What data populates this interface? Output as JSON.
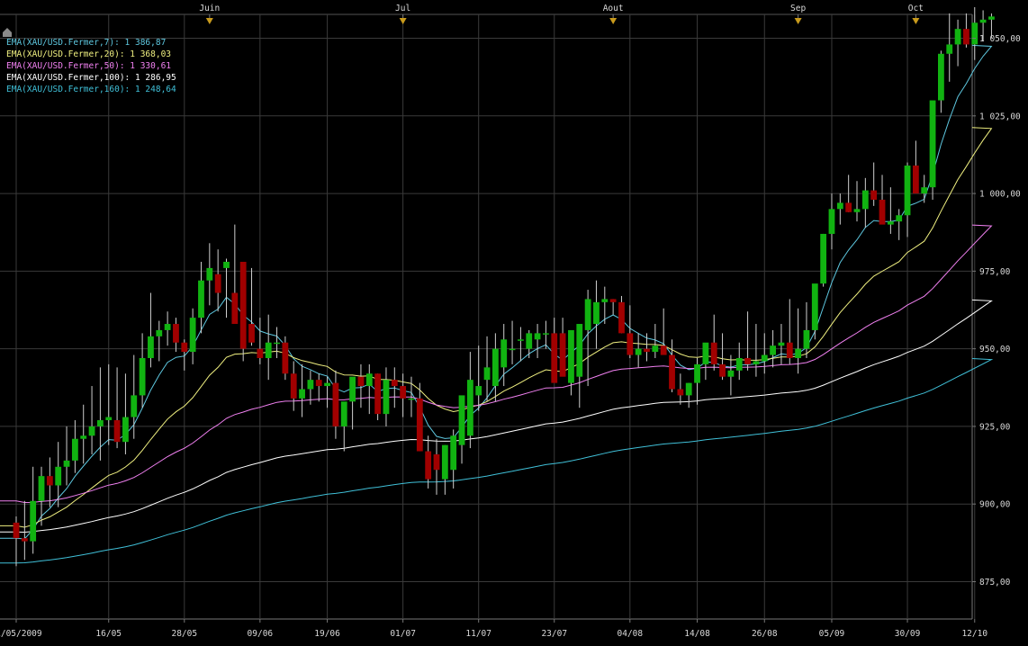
{
  "chart_data": {
    "type": "candlestick",
    "colors": {
      "up": "#11b311",
      "down": "#a10000",
      "wick": "#cfcfcf",
      "grid": "#3a3a3a",
      "axis_text": "#d9d9d9",
      "marker": "#c89a1c"
    },
    "ylim": [
      865,
      1060
    ],
    "y_ticks": [
      {
        "value": 1050,
        "label": "1 050,00"
      },
      {
        "value": 1025,
        "label": "1 025,00"
      },
      {
        "value": 1000,
        "label": "1 000,00"
      },
      {
        "value": 975,
        "label": "975,00"
      },
      {
        "value": 950,
        "label": "950,00"
      },
      {
        "value": 925,
        "label": "925,00"
      },
      {
        "value": 900,
        "label": "900,00"
      },
      {
        "value": 875,
        "label": "875,00"
      }
    ],
    "x_ticks": [
      {
        "i": 0,
        "label": "01/05/2009"
      },
      {
        "i": 11,
        "label": "16/05"
      },
      {
        "i": 20,
        "label": "28/05"
      },
      {
        "i": 29,
        "label": "09/06"
      },
      {
        "i": 37,
        "label": "19/06"
      },
      {
        "i": 46,
        "label": "01/07"
      },
      {
        "i": 55,
        "label": "11/07"
      },
      {
        "i": 64,
        "label": "23/07"
      },
      {
        "i": 73,
        "label": "04/08"
      },
      {
        "i": 81,
        "label": "14/08"
      },
      {
        "i": 89,
        "label": "26/08"
      },
      {
        "i": 97,
        "label": "05/09"
      },
      {
        "i": 106,
        "label": "30/09"
      },
      {
        "i": 114,
        "label": "12/10"
      }
    ],
    "month_markers": [
      {
        "i": 23,
        "label": "Juin"
      },
      {
        "i": 46,
        "label": "Jul"
      },
      {
        "i": 71,
        "label": "Aout"
      },
      {
        "i": 93,
        "label": "Sep"
      },
      {
        "i": 107,
        "label": "Oct"
      }
    ],
    "legend": [
      {
        "label": "EMA(XAU/USD.Fermer,7): 1 386,87",
        "color": "#5ec8e0"
      },
      {
        "label": "EMA(XAU/USD.Fermer,20): 1 368,03",
        "color": "#f0f080"
      },
      {
        "label": "EMA(XAU/USD.Fermer,50): 1 330,61",
        "color": "#f080f0"
      },
      {
        "label": "EMA(XAU/USD.Fermer,100): 1 286,95",
        "color": "#ffffff"
      },
      {
        "label": "EMA(XAU/USD.Fermer,160): 1 248,64",
        "color": "#40c0d8"
      }
    ],
    "series": {
      "open": [
        894,
        889,
        888,
        901,
        909,
        906,
        912,
        914,
        921,
        922,
        925,
        927,
        927,
        920,
        928,
        935,
        947,
        954,
        956,
        958,
        952,
        949,
        960,
        972,
        974,
        976,
        968,
        978,
        958,
        950,
        947,
        952,
        952,
        942,
        934,
        937,
        940,
        938,
        939,
        925,
        933,
        941,
        938,
        942,
        929,
        940,
        938,
        934,
        934,
        917,
        916,
        908,
        911,
        919,
        922,
        935,
        940,
        938,
        944,
        950,
        953,
        950,
        953,
        955,
        955,
        955,
        939,
        941,
        956,
        958,
        965,
        966,
        965,
        955,
        948,
        950,
        949,
        951,
        948,
        937,
        935,
        939,
        945,
        952,
        945,
        941,
        943,
        947,
        945,
        946,
        948,
        951,
        952,
        947,
        950,
        956,
        971,
        987,
        995,
        997,
        994,
        995,
        1001,
        998,
        990,
        991,
        993,
        1009,
        1000,
        1002,
        1030,
        1045,
        1048,
        1053,
        1048,
        1055,
        1056
      ],
      "high": [
        896,
        901,
        912,
        912,
        915,
        920,
        925,
        927,
        932,
        938,
        944,
        945,
        944,
        942,
        948,
        955,
        968,
        959,
        962,
        960,
        953,
        963,
        978,
        984,
        982,
        979,
        990,
        978,
        976,
        960,
        961,
        957,
        954,
        946,
        945,
        943,
        942,
        941,
        943,
        930,
        939,
        945,
        945,
        942,
        944,
        944,
        942,
        941,
        939,
        922,
        921,
        919,
        924,
        932,
        949,
        951,
        954,
        955,
        958,
        959,
        957,
        956,
        958,
        959,
        960,
        960,
        950,
        948,
        969,
        972,
        970,
        966,
        967,
        964,
        955,
        955,
        958,
        963,
        953,
        942,
        939,
        947,
        951,
        961,
        955,
        948,
        952,
        962,
        958,
        955,
        956,
        958,
        966,
        963,
        965,
        969,
        987,
        1000,
        1000,
        1006,
        1004,
        1005,
        1010,
        1006,
        1002,
        995,
        1010,
        1017,
        1006,
        1020,
        1046,
        1058,
        1056,
        1058,
        1060,
        1059,
        1058
      ],
      "low": [
        880,
        882,
        884,
        893,
        899,
        899,
        906,
        910,
        913,
        916,
        914,
        919,
        918,
        916,
        921,
        931,
        944,
        946,
        951,
        949,
        943,
        945,
        955,
        964,
        962,
        960,
        965,
        946,
        951,
        945,
        940,
        947,
        940,
        930,
        928,
        932,
        933,
        931,
        921,
        917,
        924,
        931,
        929,
        927,
        925,
        931,
        928,
        928,
        917,
        905,
        903,
        903,
        905,
        913,
        918,
        930,
        933,
        933,
        938,
        945,
        946,
        947,
        947,
        950,
        950,
        950,
        935,
        931,
        938,
        950,
        958,
        961,
        955,
        947,
        944,
        946,
        947,
        949,
        936,
        932,
        931,
        932,
        940,
        943,
        940,
        935,
        940,
        943,
        941,
        942,
        944,
        945,
        945,
        942,
        947,
        953,
        970,
        982,
        990,
        994,
        991,
        989,
        996,
        992,
        987,
        985,
        986,
        1005,
        997,
        998,
        1026,
        1036,
        1041,
        1047,
        1043,
        1049,
        1050
      ],
      "close": [
        889,
        888,
        901,
        909,
        906,
        912,
        914,
        921,
        922,
        925,
        927,
        928,
        920,
        928,
        935,
        947,
        954,
        956,
        958,
        952,
        949,
        960,
        972,
        976,
        968,
        978,
        958,
        950,
        952,
        947,
        952,
        952,
        942,
        934,
        937,
        940,
        938,
        939,
        925,
        933,
        941,
        938,
        942,
        929,
        940,
        938,
        934,
        934,
        917,
        908,
        911,
        919,
        922,
        935,
        940,
        938,
        944,
        950,
        953,
        950,
        953,
        955,
        955,
        955,
        939,
        941,
        956,
        958,
        966,
        965,
        966,
        965,
        955,
        948,
        950,
        949,
        951,
        948,
        937,
        935,
        939,
        945,
        952,
        945,
        941,
        943,
        947,
        945,
        946,
        948,
        951,
        952,
        947,
        950,
        956,
        971,
        987,
        995,
        997,
        994,
        995,
        1001,
        998,
        990,
        991,
        993,
        1009,
        1000,
        1002,
        1030,
        1045,
        1048,
        1053,
        1048,
        1055,
        1056,
        1057
      ]
    }
  }
}
